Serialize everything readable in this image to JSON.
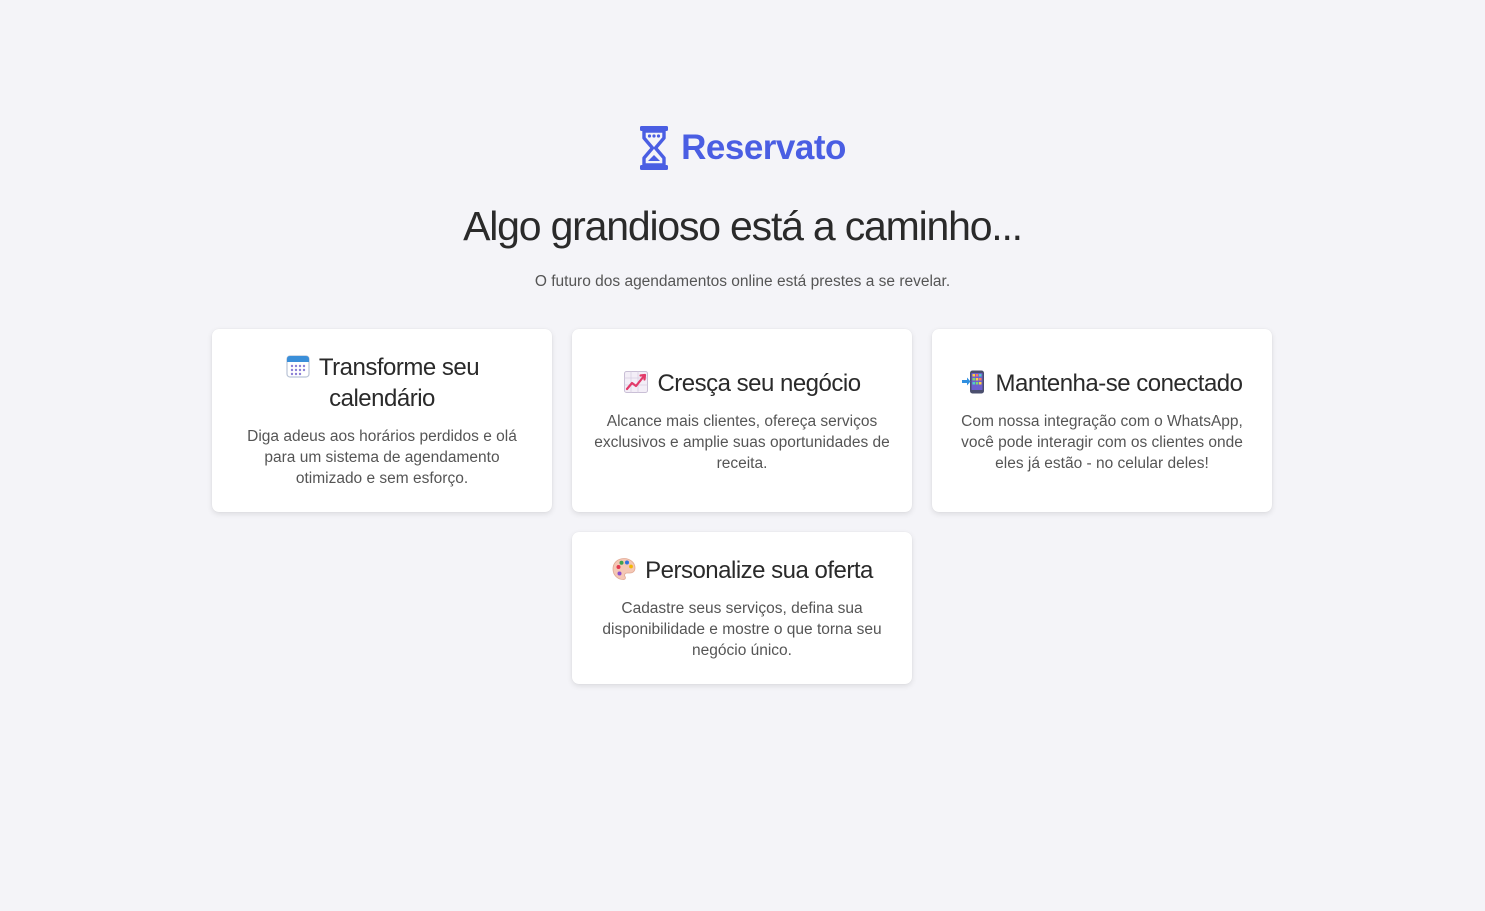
{
  "brand": {
    "name": "Reservato",
    "color": "#4a5ee3",
    "icon": "hourglass-icon"
  },
  "hero": {
    "headline": "Algo grandioso está a caminho...",
    "subtitle": "O futuro dos agendamentos online está prestes a se revelar."
  },
  "features": [
    {
      "icon": "calendar-icon",
      "title": "Transforme seu calendário",
      "text": "Diga adeus aos horários perdidos e olá para um sistema de agendamento otimizado e sem esforço."
    },
    {
      "icon": "chart-increasing-icon",
      "title": "Cresça seu negócio",
      "text": "Alcance mais clientes, ofereça serviços exclusivos e amplie suas oportunidades de receita."
    },
    {
      "icon": "mobile-phone-arrow-icon",
      "title": "Mantenha-se conectado",
      "text": "Com nossa integração com o WhatsApp, você pode interagir com os clientes onde eles já estão - no celular deles!"
    },
    {
      "icon": "artist-palette-icon",
      "title": "Personalize sua oferta",
      "text": "Cadastre seus serviços, defina sua disponibilidade e mostre o que torna seu negócio único."
    }
  ]
}
